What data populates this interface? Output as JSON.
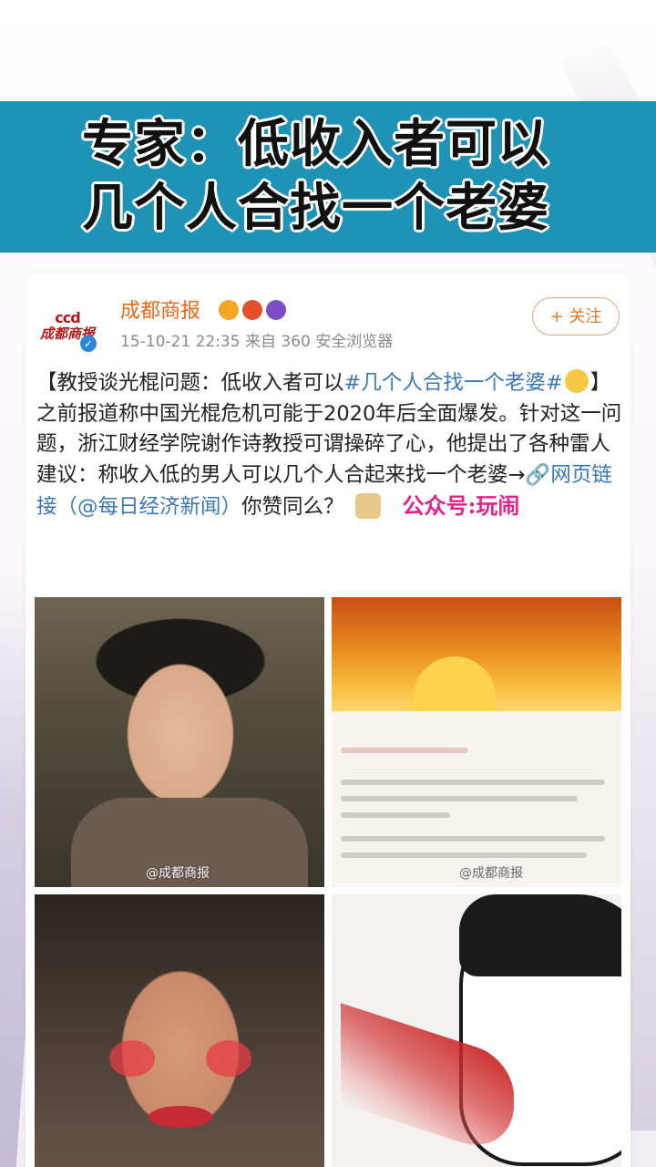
{
  "banner": {
    "line1": "专家：低收入者可以",
    "line2": "几个人合找一个老婆"
  },
  "post": {
    "logo_mark": "ccd",
    "logo_text": "成都商报",
    "user_name": "成都商报",
    "verified_icon": "✓",
    "meta": "15-10-21 22:35  来自 360 安全浏览器",
    "follow_label": "+ 关注",
    "text_1": "【教授谈光棍问题：低收入者可以",
    "hashtag": "#几个人合找一个老婆#",
    "text_2": "】之前报道称中国光棍危机可能于2020年后全面爆发。针对这一问题，浙江财经学院谢作诗教授可谓操碎了心，他提出了各种雷人建议：称收入低的男人可以几个人合起来找一个老婆→",
    "link_label": "🔗网页链接",
    "mention": "（@每日经济新闻）",
    "text_3": "你赞同么？",
    "watermark": "公众号:玩闹"
  },
  "images": {
    "img1_watermark": "@成都商报",
    "img2_watermark": "@成都商报"
  },
  "colors": {
    "banner_bg": "#1f93b5",
    "user_name": "#e86a14",
    "link": "#3a78b8",
    "watermark": "#e0248a"
  }
}
